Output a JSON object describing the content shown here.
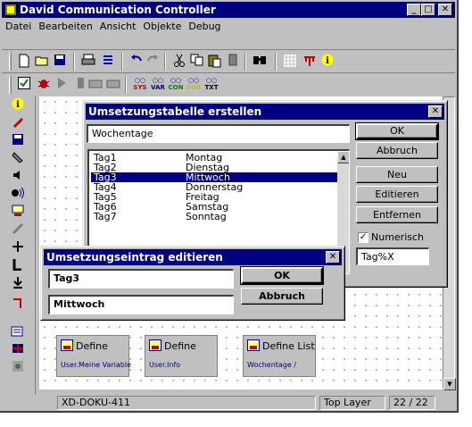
{
  "window": {
    "title": "David Communication Controller"
  },
  "title_buttons": {
    "minimize": "_",
    "maximize": "□",
    "close": "✕"
  },
  "menu": [
    "Datei",
    "Bearbeiten",
    "Ansicht",
    "Objekte",
    "Debug"
  ],
  "toolbar_icons": [
    "new-icon",
    "open-icon",
    "save-icon",
    "print-icon",
    "list-icon",
    "undo-icon",
    "redo-icon",
    "cut-icon",
    "copy-icon",
    "paste-icon",
    "delete-icon",
    "find-icon",
    "grid-icon",
    "network-icon",
    "info-icon"
  ],
  "toolbar2_labels": {
    "sys": "SYS",
    "var": "VAR",
    "con": "CON",
    "sub": "SUB",
    "txt": "TXT"
  },
  "canvas_blocks": [
    {
      "title": "Define",
      "sub": "User.Meine Variable"
    },
    {
      "title": "Define",
      "sub": "User.Info"
    },
    {
      "title": "Define List",
      "sub": "Wochentage /"
    }
  ],
  "status": {
    "doc": "XD-DOKU-411",
    "layer": "Top Layer",
    "page": "22 / 22"
  },
  "table_dialog": {
    "title": "Umsetzungstabelle erstellen",
    "name_value": "Wochentage",
    "rows": [
      {
        "key": "Tag1",
        "value": "Montag"
      },
      {
        "key": "Tag2",
        "value": "Dienstag"
      },
      {
        "key": "Tag3",
        "value": "Mittwoch"
      },
      {
        "key": "Tag4",
        "value": "Donnerstag"
      },
      {
        "key": "Tag5",
        "value": "Freitag"
      },
      {
        "key": "Tag6",
        "value": "Samstag"
      },
      {
        "key": "Tag7",
        "value": "Sonntag"
      }
    ],
    "selected_index": 2,
    "buttons": {
      "ok": "OK",
      "cancel": "Abbruch",
      "new": "Neu",
      "edit": "Editieren",
      "remove": "Entfernen"
    },
    "numeric_label": "Numerisch",
    "numeric_checked": true,
    "format_value": "Tag%X"
  },
  "entry_dialog": {
    "title": "Umsetzungseintrag editieren",
    "key_value": "Tag3",
    "val_value": "Mittwoch",
    "buttons": {
      "ok": "OK",
      "cancel": "Abbruch"
    }
  }
}
